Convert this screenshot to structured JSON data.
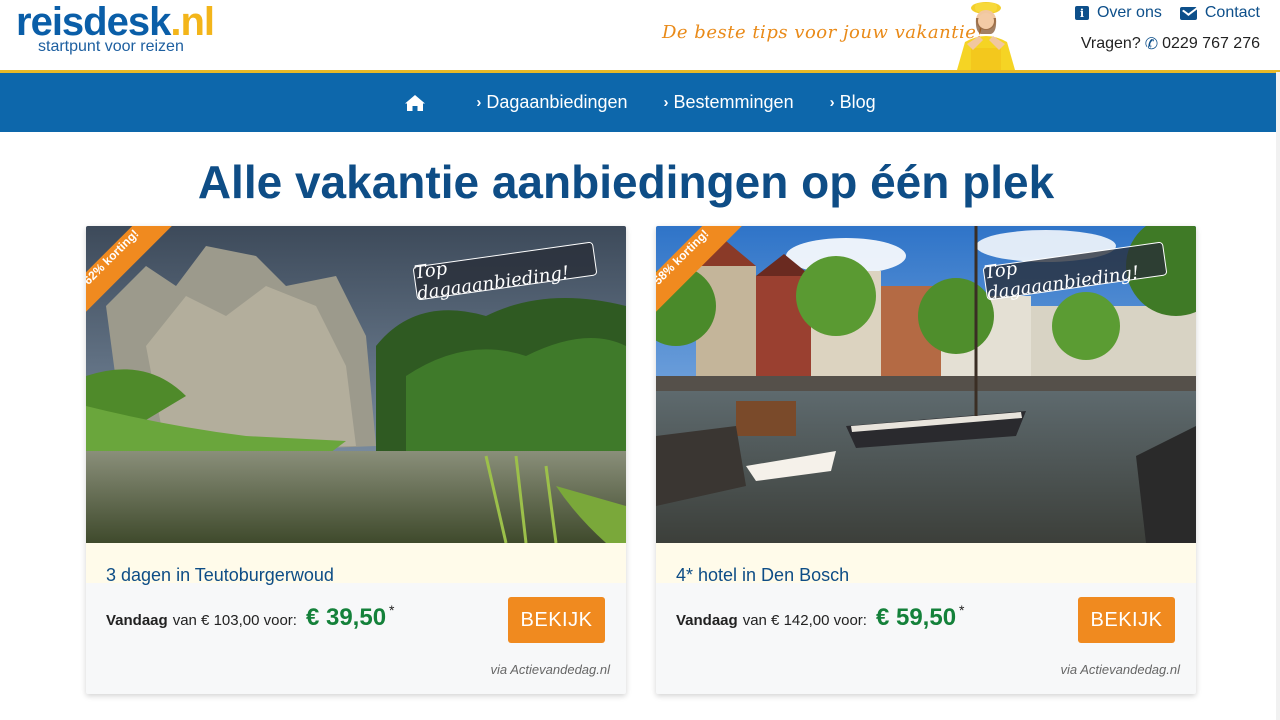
{
  "header": {
    "logo_main_1": "reis",
    "logo_main_2": "desk",
    "logo_main_3": ".nl",
    "logo_sub": "startpunt voor reizen",
    "slogan": "De beste tips voor jouw vakantie!",
    "links": [
      {
        "label": "Over ons",
        "icon": "info-icon"
      },
      {
        "label": "Contact",
        "icon": "mail-icon"
      }
    ],
    "questions_label": "Vragen?",
    "phone": "0229 767 276"
  },
  "nav": {
    "home_icon": "home-icon",
    "items": [
      {
        "label": "Dagaanbiedingen"
      },
      {
        "label": "Bestemmingen"
      },
      {
        "label": "Blog"
      }
    ]
  },
  "main": {
    "title": "Alle vakantie aanbiedingen op één plek"
  },
  "cards": [
    {
      "discount": "62% korting!",
      "badge": "Top dagaaanbieding!",
      "title": "3 dagen in Teutoburgerwoud",
      "vandaag": "Vandaag",
      "from_text": "van € 103,00 voor:",
      "price": "€ 39,50",
      "star": "*",
      "button": "BEKIJK",
      "via": "via Actievandedag.nl"
    },
    {
      "discount": "58% korting!",
      "badge": "Top dagaaanbieding!",
      "title": "4* hotel in Den Bosch",
      "vandaag": "Vandaag",
      "from_text": "van € 142,00 voor:",
      "price": "€ 59,50",
      "star": "*",
      "button": "BEKIJK",
      "via": "via Actievandedag.nl"
    }
  ],
  "colors": {
    "brand_blue": "#0d67ab",
    "accent_orange": "#f08a1f",
    "price_green": "#14813a",
    "logo_yellow": "#f3b51a"
  }
}
